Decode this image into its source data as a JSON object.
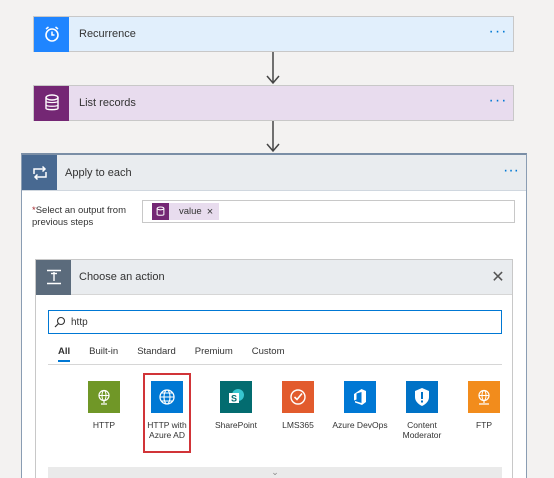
{
  "steps": {
    "recurrence": {
      "label": "Recurrence",
      "icon": "alarm-clock-icon",
      "color": "#1f85ff"
    },
    "list_records": {
      "label": "List records",
      "icon": "database-icon",
      "color": "#742774"
    },
    "more_label": "···"
  },
  "apply_each": {
    "title": "Apply to each",
    "icon": "loop-icon",
    "more_label": "···",
    "select_output": {
      "required_mark": "*",
      "label": "Select an output from previous steps",
      "token_label": "value",
      "token_remove": "×"
    }
  },
  "choose_action": {
    "title": "Choose an action",
    "close_label": "✕",
    "search": {
      "value": "http",
      "placeholder": ""
    },
    "tabs": [
      {
        "label": "All",
        "active": true
      },
      {
        "label": "Built-in",
        "active": false
      },
      {
        "label": "Standard",
        "active": false
      },
      {
        "label": "Premium",
        "active": false
      },
      {
        "label": "Custom",
        "active": false
      }
    ],
    "connectors": [
      {
        "label": "HTTP",
        "icon": "globe-icon",
        "color": "#709727"
      },
      {
        "label": "HTTP with Azure AD",
        "icon": "globe-icon",
        "color": "#0078d4",
        "selected": true
      },
      {
        "label": "SharePoint",
        "icon": "sharepoint-icon",
        "color": "#036c70"
      },
      {
        "label": "LMS365",
        "icon": "check-circle-icon",
        "color": "#e25b2d"
      },
      {
        "label": "Azure DevOps",
        "icon": "devops-icon",
        "color": "#0078d4"
      },
      {
        "label": "Content Moderator",
        "icon": "shield-icon",
        "color": "#0072c6"
      },
      {
        "label": "FTP",
        "icon": "globe-network-icon",
        "color": "#f28c1c"
      }
    ],
    "expand_label": "⌄"
  }
}
